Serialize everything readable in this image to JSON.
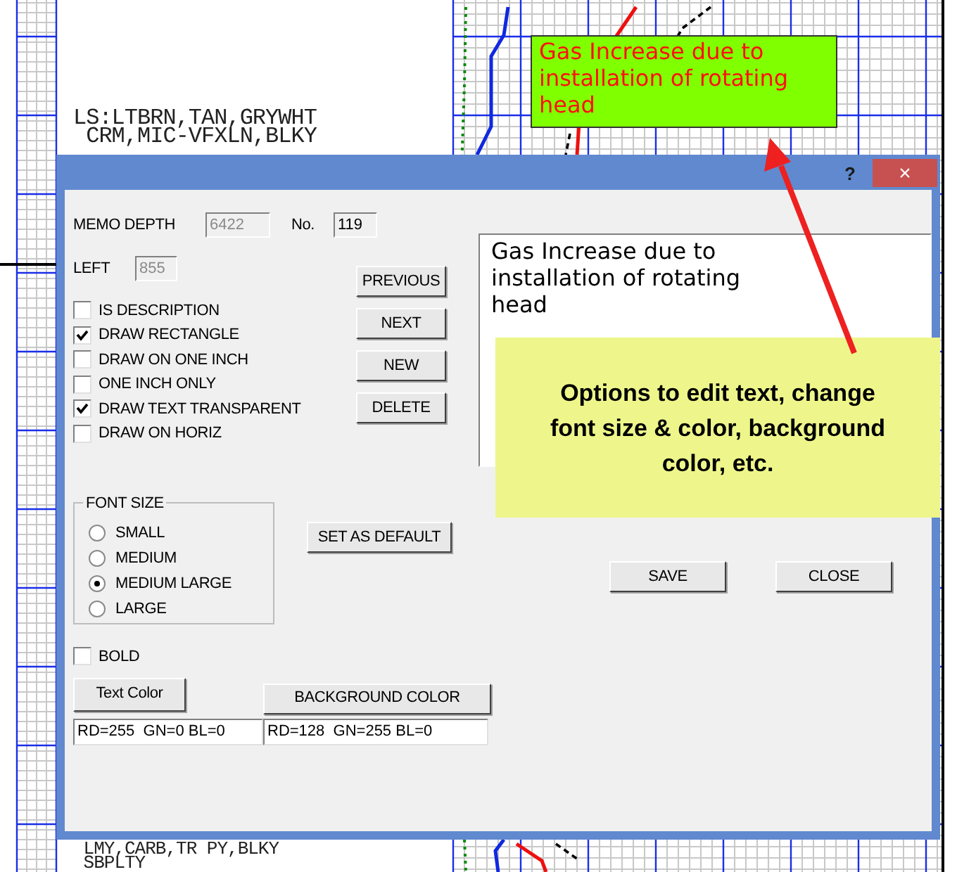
{
  "log_track": {
    "upper_lines": [
      "LS:LTBRN,TAN,GRYWHT",
      " CRM,MIC-VFXLN,BLKY"
    ],
    "lower_lines": [
      " LMY,CARB,TR PY,BLKY",
      " SBPLTY"
    ]
  },
  "memo_note": {
    "text": "Gas Increase due to installation of rotating head"
  },
  "dialog": {
    "help": "?",
    "close": "×",
    "memo_depth": {
      "label": "MEMO DEPTH",
      "value": "6422",
      "disabled": true
    },
    "number": {
      "label": "No.",
      "value": "119",
      "disabled": false
    },
    "left": {
      "label": "LEFT",
      "value": "855",
      "disabled": true
    },
    "options": [
      {
        "label": "IS DESCRIPTION",
        "checked": false
      },
      {
        "label": "DRAW RECTANGLE",
        "checked": true
      },
      {
        "label": "DRAW ON ONE INCH",
        "checked": false
      },
      {
        "label": "ONE INCH ONLY",
        "checked": false
      },
      {
        "label": "DRAW TEXT TRANSPARENT",
        "checked": true
      },
      {
        "label": "DRAW ON HORIZ",
        "checked": false
      }
    ],
    "nav_buttons": [
      "PREVIOUS",
      "NEXT",
      "NEW",
      "DELETE"
    ],
    "font_size": {
      "title": "FONT SIZE",
      "options": [
        {
          "label": "SMALL",
          "selected": false
        },
        {
          "label": "MEDIUM",
          "selected": false
        },
        {
          "label": "MEDIUM LARGE",
          "selected": true
        },
        {
          "label": "LARGE",
          "selected": false
        }
      ]
    },
    "set_default": "SET AS DEFAULT",
    "bold": {
      "label": "BOLD",
      "checked": false
    },
    "text_color": {
      "button": "Text Color",
      "value": "RD=255  GN=0 BL=0"
    },
    "background_color": {
      "button": "BACKGROUND COLOR",
      "value": "RD=128  GN=255 BL=0"
    },
    "memo_text": "Gas Increase due to installation of rotating head",
    "buttons": [
      "SAVE",
      "CLOSE"
    ]
  },
  "callout": {
    "text": "Options to edit text, change font size & color, background color, etc."
  }
}
